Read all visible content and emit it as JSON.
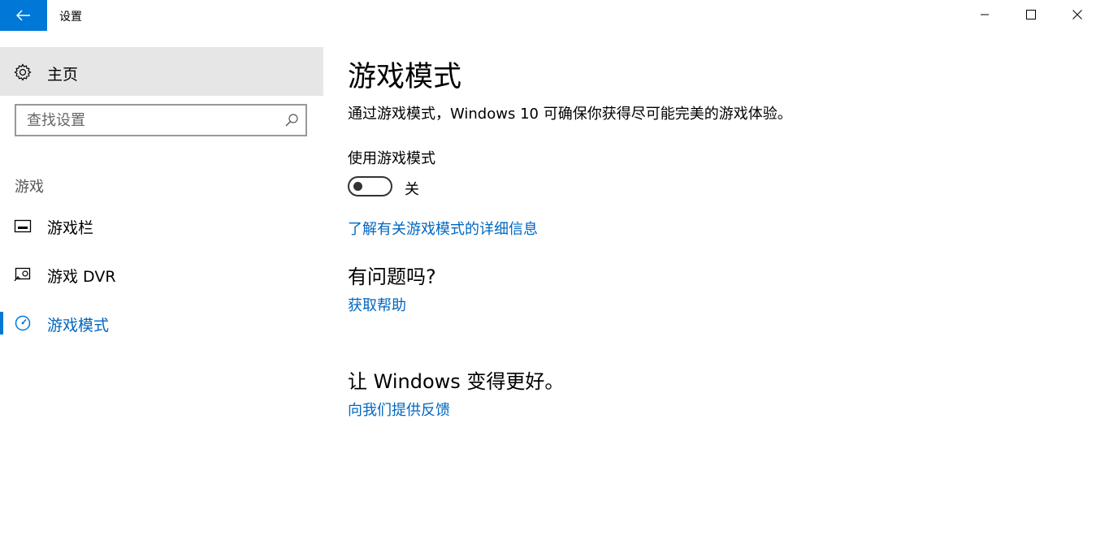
{
  "window": {
    "title": "设置"
  },
  "sidebar": {
    "home_label": "主页",
    "search": {
      "placeholder": "查找设置",
      "value": ""
    },
    "section_label": "游戏",
    "items": [
      {
        "label": "游戏栏",
        "icon": "game-bar-icon",
        "active": false
      },
      {
        "label": "游戏 DVR",
        "icon": "game-dvr-icon",
        "active": false
      },
      {
        "label": "游戏模式",
        "icon": "game-mode-icon",
        "active": true
      }
    ]
  },
  "main": {
    "title": "游戏模式",
    "description": "通过游戏模式，Windows 10 可确保你获得尽可能完美的游戏体验。",
    "toggle": {
      "label": "使用游戏模式",
      "state_text": "关",
      "on": false
    },
    "learn_more_link": "了解有关游戏模式的详细信息",
    "question_title": "有问题吗?",
    "help_link": "获取帮助",
    "improve_title": "让 Windows 变得更好。",
    "feedback_link": "向我们提供反馈"
  },
  "colors": {
    "accent": "#0078d7",
    "link": "#0067c0",
    "home_bg": "#e6e6e6"
  }
}
